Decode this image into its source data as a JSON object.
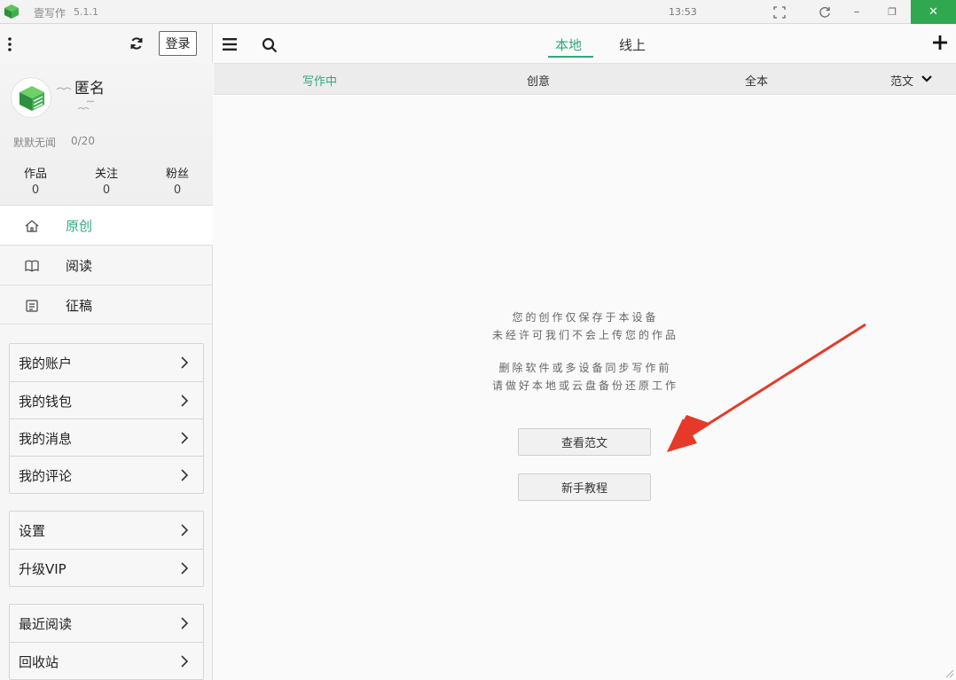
{
  "window": {
    "app_name": "壹写作",
    "version": "5.1.1",
    "clock": "13:53",
    "close_glyph": "✕",
    "minimize_glyph": "–",
    "restore_glyph": "❐",
    "accent_color": "#2fa84f"
  },
  "sidebar": {
    "login_label": "登录",
    "username": "匿名",
    "signature": "默默无闻",
    "signature_count": "0/20",
    "stats": [
      {
        "label": "作品",
        "value": "0"
      },
      {
        "label": "关注",
        "value": "0"
      },
      {
        "label": "粉丝",
        "value": "0"
      }
    ],
    "nav": [
      {
        "label": "原创",
        "icon": "home-icon",
        "active": true
      },
      {
        "label": "阅读",
        "icon": "book-icon",
        "active": false
      },
      {
        "label": "征稿",
        "icon": "document-icon",
        "active": false
      }
    ],
    "group1": [
      "我的账户",
      "我的钱包",
      "我的消息",
      "我的评论"
    ],
    "group2": [
      "设置",
      "升级VIP"
    ],
    "group3": [
      "最近阅读",
      "回收站"
    ]
  },
  "main": {
    "tabs": [
      "本地",
      "线上"
    ],
    "active_tab": "本地",
    "subtabs": [
      "写作中",
      "创意",
      "全本",
      "范文"
    ],
    "active_subtab": "写作中",
    "accent_color": "#2fa87a",
    "empty_lines": [
      "您的创作仅保存于本设备",
      "未经许可我们不会上传您的作品",
      "删除软件或多设备同步写作前",
      "请做好本地或云盘备份还原工作"
    ],
    "buttons": [
      "查看范文",
      "新手教程"
    ]
  }
}
